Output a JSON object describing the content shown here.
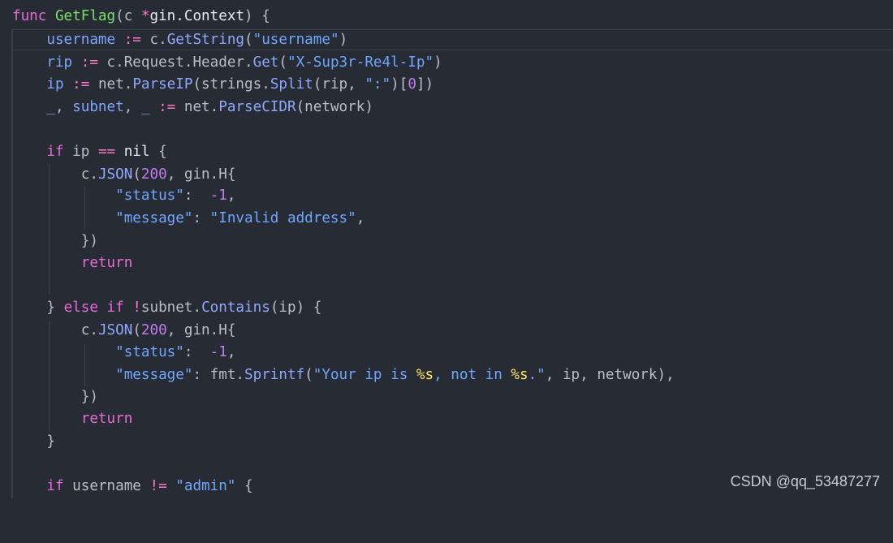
{
  "code": {
    "l1": {
      "kw": "func",
      "name": "GetFlag",
      "p1": "(c ",
      "star": "*",
      "type": "gin.Context",
      "p2": ") {"
    },
    "l2": {
      "v": "username",
      "op": ":=",
      "obj": "c.",
      "fn": "GetString",
      "p1": "(",
      "s": "\"username\"",
      "p2": ")"
    },
    "l3": {
      "v": "rip",
      "op": ":=",
      "obj": "c.Request.Header.",
      "fn": "Get",
      "p1": "(",
      "s": "\"X-Sup3r-Re4l-Ip\"",
      "p2": ")"
    },
    "l4": {
      "v": "ip",
      "op": ":=",
      "obj": "net.",
      "fn": "ParseIP",
      "p1": "(strings.",
      "fn2": "Split",
      "p2": "(rip, ",
      "s": "\":\"",
      "p3": ")[",
      "n": "0",
      "p4": "])"
    },
    "l5": {
      "u1": "_",
      "c1": ", ",
      "v": "subnet",
      "c2": ", ",
      "u2": "_",
      "op": ":=",
      "obj": "net.",
      "fn": "ParseCIDR",
      "p1": "(network)"
    },
    "l7": {
      "kw": "if",
      "a": " ip ",
      "op": "==",
      "b": " ",
      "nil": "nil",
      "c": " {"
    },
    "l8": {
      "obj": "c.",
      "fn": "JSON",
      "p1": "(",
      "n": "200",
      "p2": ", gin.H{"
    },
    "l9": {
      "s": "\"status\"",
      "p1": ":  ",
      "n": "-1",
      "p2": ","
    },
    "l10": {
      "s": "\"message\"",
      "p1": ": ",
      "s2": "\"Invalid address\"",
      "p2": ","
    },
    "l11": {
      "t": "})"
    },
    "l12": {
      "kw": "return"
    },
    "l14": {
      "b1": "} ",
      "kw1": "else",
      "sp": " ",
      "kw2": "if",
      "sp2": " ",
      "op": "!",
      "obj": "subnet.",
      "fn": "Contains",
      "p1": "(ip) {"
    },
    "l15": {
      "obj": "c.",
      "fn": "JSON",
      "p1": "(",
      "n": "200",
      "p2": ", gin.H{"
    },
    "l16": {
      "s": "\"status\"",
      "p1": ":  ",
      "n": "-1",
      "p2": ","
    },
    "l17": {
      "s": "\"message\"",
      "p1": ": fmt.",
      "fn": "Sprintf",
      "p2": "(",
      "s1": "\"Your ip is ",
      "f1": "%s",
      "s2": ", not in ",
      "f2": "%s",
      "s3": ".\"",
      "p3": ", ip, network),"
    },
    "l18": {
      "t": "})"
    },
    "l19": {
      "kw": "return"
    },
    "l20": {
      "t": "}"
    },
    "l22": {
      "kw": "if",
      "a": " username ",
      "op": "!=",
      "b": " ",
      "s": "\"admin\"",
      "c": " {"
    }
  },
  "watermark": "CSDN @qq_53487277"
}
